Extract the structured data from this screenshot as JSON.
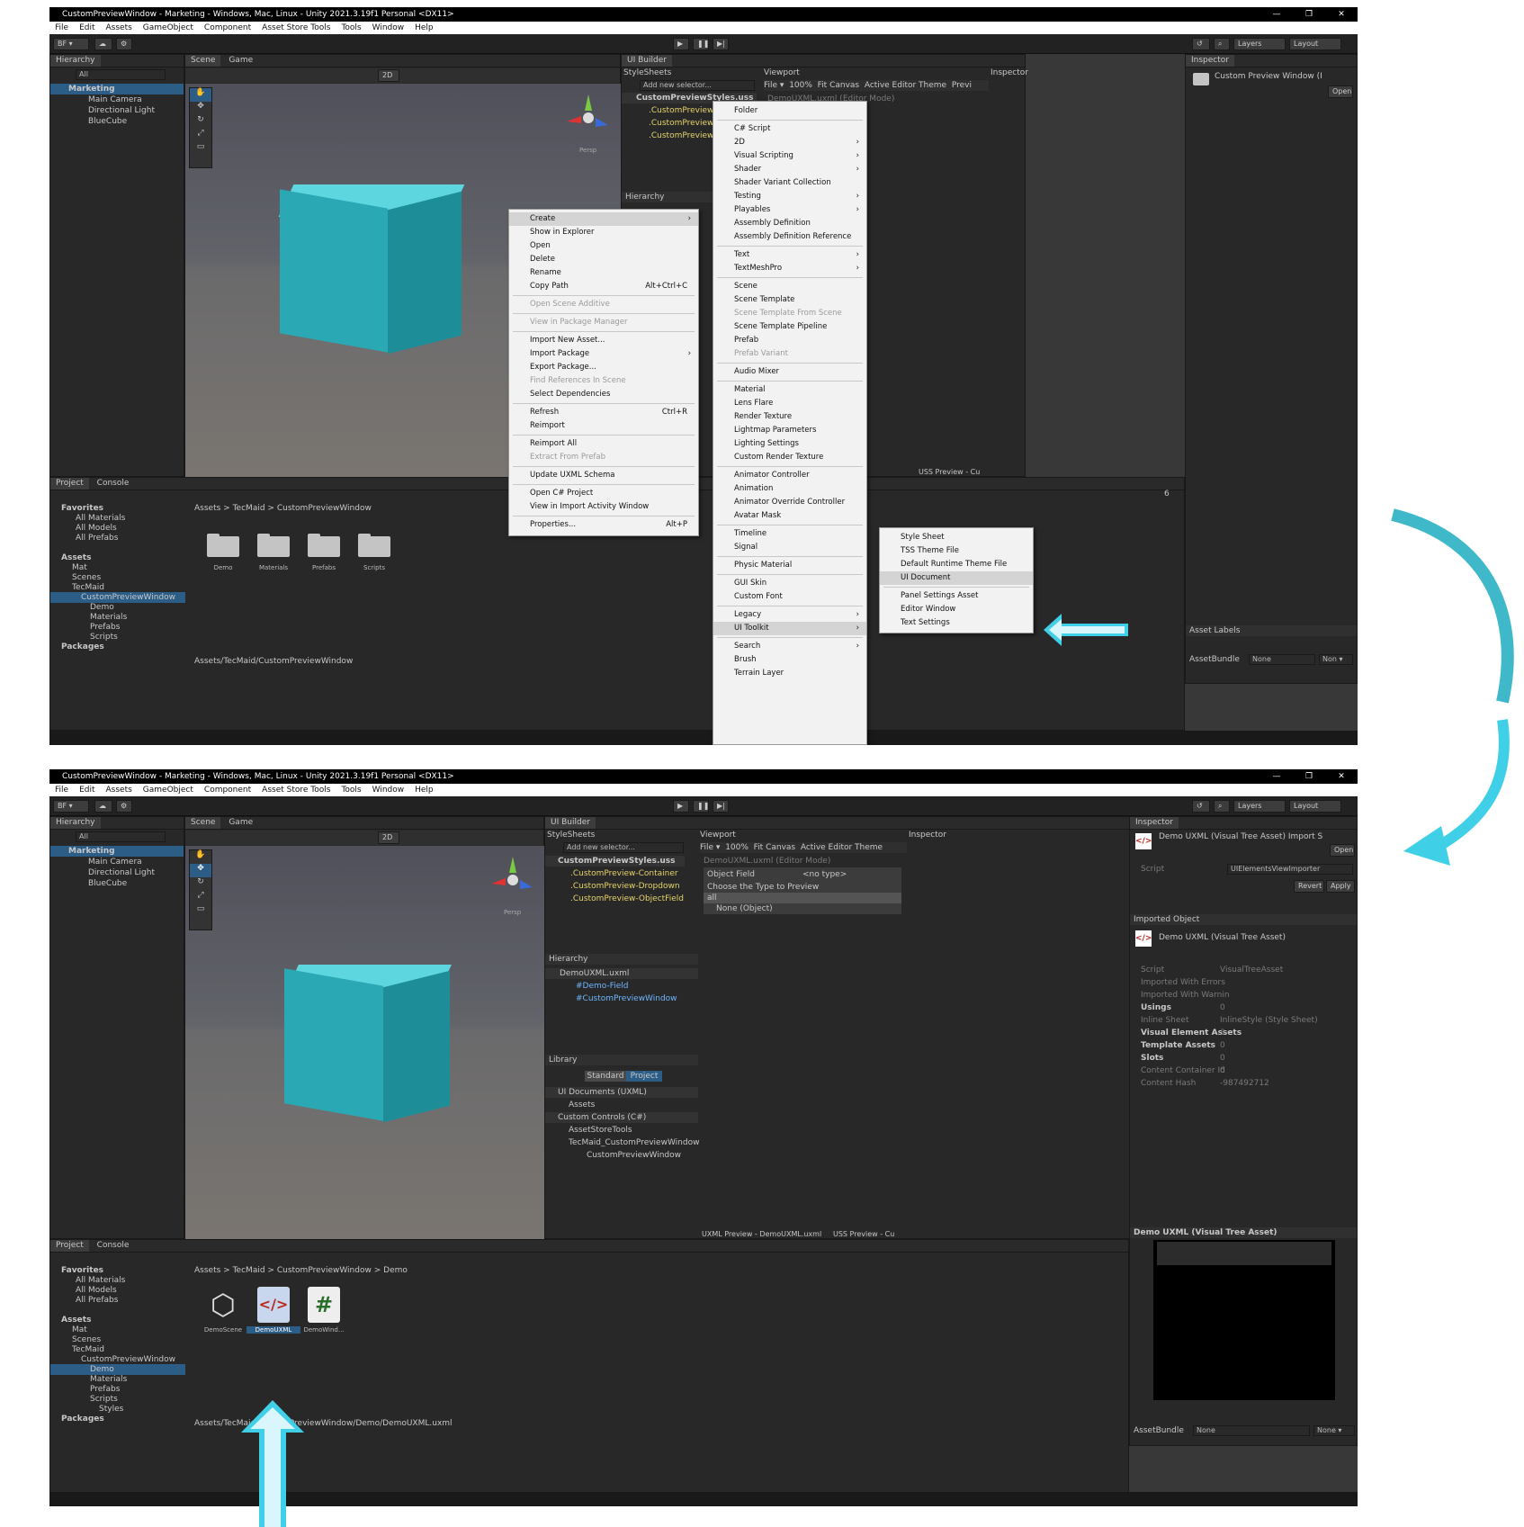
{
  "top": {
    "window_title": "CustomPreviewWindow - Marketing - Windows, Mac, Linux - Unity 2021.3.19f1 Personal <DX11>",
    "menu": [
      "File",
      "Edit",
      "Assets",
      "GameObject",
      "Component",
      "Asset Store Tools",
      "Tools",
      "Window",
      "Help"
    ],
    "window_controls": [
      "—",
      "❐",
      "✕"
    ],
    "toolbar": {
      "account": "BF ▾",
      "layers": "Layers",
      "layout": "Layout"
    },
    "hierarchy": {
      "tab": "Hierarchy",
      "search": "All",
      "items": [
        "Marketing",
        "Main Camera",
        "Directional Light",
        "BlueCube"
      ]
    },
    "scene_tabs": [
      "Scene",
      "Game"
    ],
    "scene_toolbar": {
      "mode2d": "2D"
    },
    "persp_label": "Persp",
    "ui_builder": {
      "tab": "UI Builder",
      "stylesheets": "StyleSheets",
      "add_selector": "Add new selector...",
      "uss": "CustomPreviewStyles.uss",
      "selectors": [
        ".CustomPreview-Container",
        ".CustomPreview-Dropdown",
        ".CustomPreview-ObjectField"
      ],
      "hierarchy": "Hierarchy",
      "viewport": "Viewport",
      "file": "File ▾",
      "zoom": "100%",
      "fit": "Fit Canvas",
      "theme": "Active Editor Theme",
      "preview": "Previ",
      "doc": "DemoUXML.uxml",
      "editor_mode": "Editor Mode",
      "inspector": "Inspector",
      "uss_preview": "USS Preview - Cu"
    },
    "inspector": {
      "tab": "Inspector",
      "title": "Custom Preview Window (I",
      "open": "Open",
      "asset_labels": "Asset Labels",
      "assetbundle": "AssetBundle",
      "none": "None",
      "non": "Non ▾"
    },
    "project": {
      "tabs": [
        "Project",
        "Console"
      ],
      "tree": [
        "Favorites",
        "All Materials",
        "All Models",
        "All Prefabs",
        "Assets",
        "Mat",
        "Scenes",
        "TecMaid",
        "CustomPreviewWindow",
        "Demo",
        "Materials",
        "Prefabs",
        "Scripts",
        "Packages"
      ],
      "breadcrumb": [
        "Assets",
        ">",
        "TecMaid",
        ">",
        "CustomPreviewWindow"
      ],
      "folders": [
        "Demo",
        "Materials",
        "Prefabs",
        "Scripts"
      ],
      "path": "Assets/TecMaid/CustomPreviewWindow",
      "count": "6"
    },
    "context_menu": [
      {
        "label": "Create",
        "arrow": "›",
        "sel": true
      },
      {
        "label": "Show in Explorer"
      },
      {
        "label": "Open"
      },
      {
        "label": "Delete"
      },
      {
        "label": "Rename"
      },
      {
        "label": "Copy Path",
        "shortcut": "Alt+Ctrl+C"
      },
      {
        "label": "Open Scene Additive",
        "dis": true
      },
      {
        "label": "View in Package Manager",
        "dis": true
      },
      {
        "label": "Import New Asset..."
      },
      {
        "label": "Import Package",
        "arrow": "›"
      },
      {
        "label": "Export Package..."
      },
      {
        "label": "Find References In Scene",
        "dis": true
      },
      {
        "label": "Select Dependencies"
      },
      {
        "label": "Refresh",
        "shortcut": "Ctrl+R"
      },
      {
        "label": "Reimport"
      },
      {
        "label": "Reimport All"
      },
      {
        "label": "Extract From Prefab",
        "dis": true
      },
      {
        "label": "Update UXML Schema"
      },
      {
        "label": "Open C# Project"
      },
      {
        "label": "View in Import Activity Window"
      },
      {
        "label": "Properties...",
        "shortcut": "Alt+P"
      }
    ],
    "create_menu": [
      {
        "label": "Folder"
      },
      {
        "label": "C# Script"
      },
      {
        "label": "2D",
        "arrow": "›"
      },
      {
        "label": "Visual Scripting",
        "arrow": "›"
      },
      {
        "label": "Shader",
        "arrow": "›"
      },
      {
        "label": "Shader Variant Collection"
      },
      {
        "label": "Testing",
        "arrow": "›"
      },
      {
        "label": "Playables",
        "arrow": "›"
      },
      {
        "label": "Assembly Definition"
      },
      {
        "label": "Assembly Definition Reference"
      },
      {
        "label": "Text",
        "arrow": "›"
      },
      {
        "label": "TextMeshPro",
        "arrow": "›"
      },
      {
        "label": "Scene"
      },
      {
        "label": "Scene Template"
      },
      {
        "label": "Scene Template From Scene",
        "dis": true
      },
      {
        "label": "Scene Template Pipeline"
      },
      {
        "label": "Prefab"
      },
      {
        "label": "Prefab Variant",
        "dis": true
      },
      {
        "label": "Audio Mixer"
      },
      {
        "label": "Material"
      },
      {
        "label": "Lens Flare"
      },
      {
        "label": "Render Texture"
      },
      {
        "label": "Lightmap Parameters"
      },
      {
        "label": "Lighting Settings"
      },
      {
        "label": "Custom Render Texture"
      },
      {
        "label": "Animator Controller"
      },
      {
        "label": "Animation"
      },
      {
        "label": "Animator Override Controller"
      },
      {
        "label": "Avatar Mask"
      },
      {
        "label": "Timeline"
      },
      {
        "label": "Signal"
      },
      {
        "label": "Physic Material"
      },
      {
        "label": "GUI Skin"
      },
      {
        "label": "Custom Font"
      },
      {
        "label": "Legacy",
        "arrow": "›"
      },
      {
        "label": "UI Toolkit",
        "arrow": "›",
        "sel": true
      },
      {
        "label": "Search",
        "arrow": "›"
      },
      {
        "label": "Brush"
      },
      {
        "label": "Terrain Layer"
      }
    ],
    "toolkit_menu": [
      {
        "label": "Style Sheet"
      },
      {
        "label": "TSS Theme File"
      },
      {
        "label": "Default Runtime Theme File"
      },
      {
        "label": "UI Document",
        "sel": true
      },
      {
        "label": "Panel Settings Asset"
      },
      {
        "label": "Editor Window"
      },
      {
        "label": "Text Settings"
      }
    ]
  },
  "bottom": {
    "window_title": "CustomPreviewWindow - Marketing - Windows, Mac, Linux - Unity 2021.3.19f1 Personal <DX11>",
    "ui_builder": {
      "tab": "UI Builder",
      "stylesheets": "StyleSheets",
      "add_selector": "Add new selector...",
      "uss": "CustomPreviewStyles.uss",
      "selectors": [
        ".CustomPreview-Container",
        ".CustomPreview-Dropdown",
        ".CustomPreview-ObjectField"
      ],
      "hierarchy": "Hierarchy",
      "doc": "DemoUXML.uxml",
      "hier_items": [
        "#Demo-Field",
        "#CustomPreviewWindow"
      ],
      "library": "Library",
      "lib_tabs": [
        "Standard",
        "Project"
      ],
      "lib_items": [
        "UI Documents (UXML)",
        "Assets",
        "Custom Controls (C#)",
        "AssetStoreTools",
        "TecMaid_CustomPreviewWindow",
        "CustomPreviewWindow"
      ],
      "viewport": "Viewport",
      "file": "File ▾",
      "zoom": "100%",
      "fit": "Fit Canvas",
      "theme": "Active Editor Theme",
      "doc_title": "DemoUXML.uxml",
      "editor_mode": "Editor Mode",
      "object_field": "Object Field",
      "no_type": "<no type>",
      "choose": "Choose the Type to Preview",
      "all": "all",
      "none_obj": "None (Object)",
      "inspector": "Inspector",
      "uxml_preview": "UXML Preview - DemoUXML.uxml",
      "uss_preview": "USS Preview - Cu"
    },
    "inspector": {
      "tab": "Inspector",
      "title": "Demo UXML (Visual Tree Asset) Import S",
      "open": "Open",
      "script_label": "Script",
      "script_val": "UIElementsViewImporter",
      "revert": "Revert",
      "apply": "Apply",
      "imported_object": "Imported Object",
      "asset_title": "Demo UXML (Visual Tree Asset)",
      "rows": [
        {
          "k": "Script",
          "v": "VisualTreeAsset"
        },
        {
          "k": "Imported With Errors",
          "v": ""
        },
        {
          "k": "Imported With Warnin",
          "v": ""
        },
        {
          "k": "Usings",
          "v": "0",
          "bold": true
        },
        {
          "k": "Inline Sheet",
          "v": "InlineStyle (Style Sheet)"
        },
        {
          "k": "Visual Element Assets",
          "v": "3",
          "bold": true
        },
        {
          "k": "Template Assets",
          "v": "0",
          "bold": true
        },
        {
          "k": "Slots",
          "v": "0",
          "bold": true
        },
        {
          "k": "Content Container Id",
          "v": "0"
        },
        {
          "k": "Content Hash",
          "v": "-987492712"
        }
      ],
      "preview_title": "Demo UXML (Visual Tree Asset)",
      "assetbundle": "AssetBundle",
      "none": "None",
      "none2": "None ▾"
    },
    "project": {
      "breadcrumb": [
        "Assets",
        ">",
        "TecMaid",
        ">",
        "CustomPreviewWindow",
        ">",
        "Demo"
      ],
      "tree": [
        "Favorites",
        "All Materials",
        "All Models",
        "All Prefabs",
        "Assets",
        "Mat",
        "Scenes",
        "TecMaid",
        "CustomPreviewWindow",
        "Demo",
        "Materials",
        "Prefabs",
        "Scripts",
        "Styles",
        "Packages"
      ],
      "files": [
        "DemoScene",
        "DemoUXML",
        "DemoWind..."
      ],
      "path": "Assets/TecMaid/CustomPreviewWindow/Demo/DemoUXML.uxml"
    }
  },
  "colors": {
    "accent": "#3fd0e8",
    "selection": "#2c5d87",
    "uxml_red": "#b8281c",
    "csharp_green": "#2a6e2a"
  }
}
